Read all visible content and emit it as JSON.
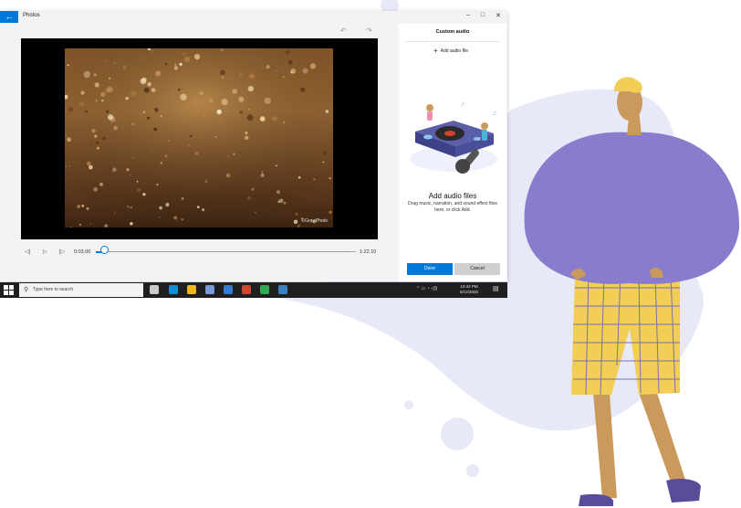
{
  "window": {
    "title": "Photos",
    "back_icon": "back-arrow-icon",
    "controls": [
      "–",
      "□",
      "✕"
    ],
    "undo_icon": "↶",
    "redo_icon": "↷"
  },
  "video": {
    "watermark": "©Gray.Photo",
    "current_time": "0:03.00",
    "total_time": "1:22.10",
    "progress": 0.036,
    "buttons": [
      "◁|",
      "▷",
      "|▷"
    ]
  },
  "panel": {
    "title": "Custom audio",
    "add_audio_label": "Add audio file",
    "drop_title": "Add audio files",
    "drop_description": "Drag music, narration, and sound effect files here, or click Add.",
    "done_label": "Done",
    "cancel_label": "Cancel"
  },
  "taskbar": {
    "search_placeholder": "Type here to search",
    "time": "10:42 PM",
    "date": "5/12/2020",
    "tray_icons": "⌃ ▭ ◔ ◁))",
    "app_colors": [
      "#c9c9c9",
      "#0b8fd8",
      "#f2b623",
      "#7a9ad6",
      "#2f7bd6",
      "#d2452f",
      "#2fa84f",
      "#3a7fc1"
    ]
  },
  "colors": {
    "accent": "#0078d7",
    "blob": "#e7e8f8",
    "shirt": "#8a7ccc",
    "pants": "#f2ce57"
  }
}
